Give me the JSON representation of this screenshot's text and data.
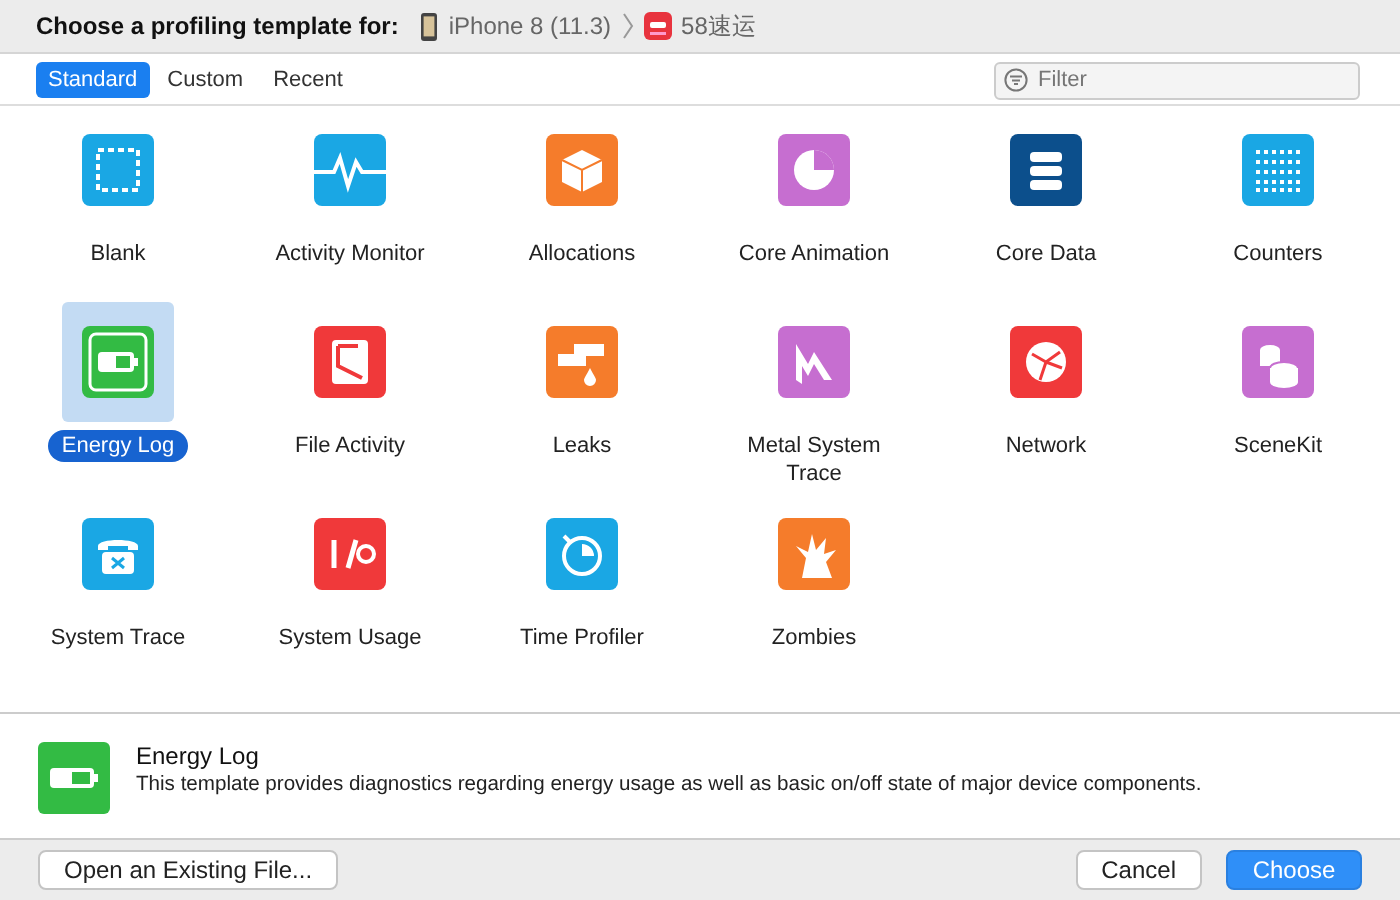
{
  "window": {
    "title": "Choose a profiling template for:"
  },
  "device": {
    "name": "iPhone 8 (11.3)",
    "app": "58速运"
  },
  "tabs": [
    {
      "label": "Standard",
      "selected": true
    },
    {
      "label": "Custom",
      "selected": false
    },
    {
      "label": "Recent",
      "selected": false
    }
  ],
  "search": {
    "placeholder": "Filter"
  },
  "templates": [
    {
      "label": "Blank",
      "color": "#1aa7e4",
      "selected": false
    },
    {
      "label": "Activity Monitor",
      "color": "#1aa7e4",
      "selected": false
    },
    {
      "label": "Allocations",
      "color": "#f57c2b",
      "selected": false
    },
    {
      "label": "Core Animation",
      "color": "#c66ed0",
      "selected": false
    },
    {
      "label": "Core Data",
      "color": "#0c4f8c",
      "selected": false
    },
    {
      "label": "Counters",
      "color": "#1aa7e4",
      "selected": false
    },
    {
      "label": "Energy Log",
      "color": "#33bb44",
      "selected": true
    },
    {
      "label": "File Activity",
      "color": "#f0393a",
      "selected": false
    },
    {
      "label": "Leaks",
      "color": "#f57c2b",
      "selected": false
    },
    {
      "label": "Metal System Trace",
      "color": "#c66ed0",
      "selected": false
    },
    {
      "label": "Network",
      "color": "#f0393a",
      "selected": false
    },
    {
      "label": "SceneKit",
      "color": "#c66ed0",
      "selected": false
    },
    {
      "label": "System Trace",
      "color": "#1aa7e4",
      "selected": false
    },
    {
      "label": "System Usage",
      "color": "#f0393a",
      "selected": false
    },
    {
      "label": "Time Profiler",
      "color": "#1aa7e4",
      "selected": false
    },
    {
      "label": "Zombies",
      "color": "#f57c2b",
      "selected": false
    }
  ],
  "detail": {
    "title": "Energy Log",
    "description": "This template provides diagnostics regarding energy usage as well as basic on/off state of major device components."
  },
  "buttons": {
    "open": "Open an Existing File...",
    "cancel": "Cancel",
    "choose": "Choose"
  }
}
